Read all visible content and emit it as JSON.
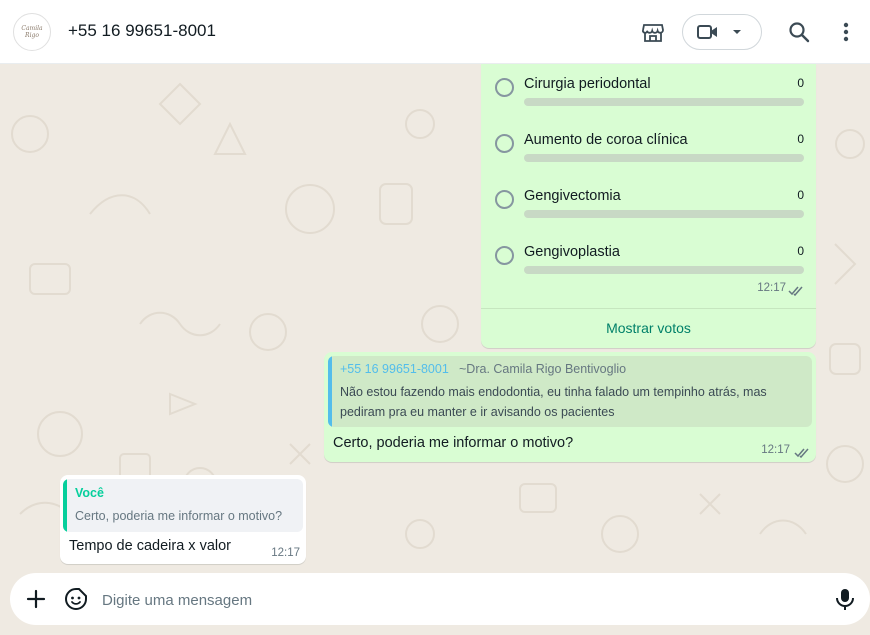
{
  "header": {
    "avatar_text": "Camila Rigo",
    "contact_name": "+55 16 99651-8001"
  },
  "poll": {
    "options": [
      {
        "label": "Cirurgia periodontal",
        "count": "0",
        "fraction": 0
      },
      {
        "label": "Aumento de coroa clínica",
        "count": "0",
        "fraction": 0
      },
      {
        "label": "Gengivectomia",
        "count": "0",
        "fraction": 0
      },
      {
        "label": "Gengivoplastia",
        "count": "0",
        "fraction": 0
      }
    ],
    "time": "12:17",
    "show_votes_label": "Mostrar votos"
  },
  "outgoing": {
    "quote_author": "+55 16 99651-8001",
    "quote_alias": "~Dra. Camila Rigo Bentivoglio",
    "quote_text": "Não estou fazendo mais endodontia, eu tinha falado um tempinho atrás, mas pediram pra eu manter e ir avisando os pacientes",
    "text": "Certo, poderia me informar o motivo?",
    "time": "12:17"
  },
  "incoming": {
    "quote_author": "Você",
    "quote_text": "Certo, poderia me informar o motivo?",
    "text": "Tempo de cadeira x valor",
    "time": "12:17"
  },
  "composer": {
    "placeholder": "Digite uma mensagem"
  },
  "colors": {
    "outgoing_bubble": "#d9fdd3",
    "incoming_bubble": "#ffffff",
    "accent": "#008069",
    "quote_blue": "#53bdeb",
    "quote_green": "#06cf9c",
    "read_ticks": "#667781"
  }
}
